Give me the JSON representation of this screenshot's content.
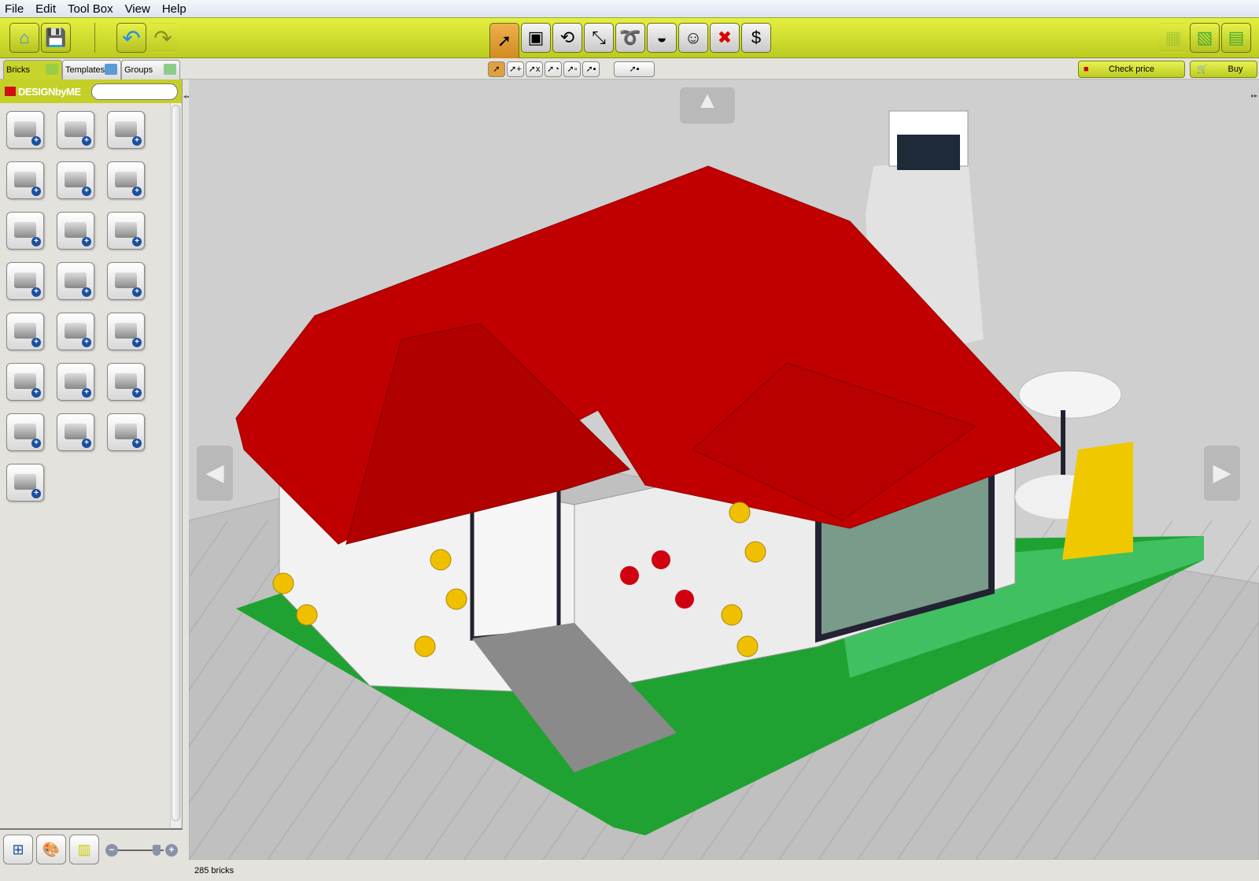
{
  "menu": [
    "File",
    "Edit",
    "Tool Box",
    "View",
    "Help"
  ],
  "toolbar": {
    "left": [
      {
        "icon": "home-icon",
        "g": "⌂"
      },
      {
        "icon": "save-icon",
        "g": "💾"
      },
      {
        "icon": "undo-icon",
        "g": "↶"
      },
      {
        "icon": "redo-icon",
        "g": "↷"
      }
    ],
    "center": [
      {
        "icon": "select-icon",
        "g": "➚"
      },
      {
        "icon": "add-brick-icon",
        "g": "▣"
      },
      {
        "icon": "hinge-icon",
        "g": "⟲"
      },
      {
        "icon": "hinge-align-icon",
        "g": "⤡"
      },
      {
        "icon": "flex-icon",
        "g": "➰"
      },
      {
        "icon": "paint-bucket-icon",
        "g": "◒"
      },
      {
        "icon": "minifig-head-icon",
        "g": "☺"
      },
      {
        "icon": "delete-icon",
        "g": "✖"
      },
      {
        "icon": "clone-icon",
        "g": "$"
      }
    ],
    "right": [
      {
        "icon": "build-mode-icon",
        "g": "▦"
      },
      {
        "icon": "view-mode-icon",
        "g": "▧"
      },
      {
        "icon": "building-guide-icon",
        "g": "▤"
      }
    ]
  },
  "tabs": [
    {
      "label": "Bricks"
    },
    {
      "label": "Templates"
    },
    {
      "label": "Groups"
    }
  ],
  "subtools": [
    "➚",
    "➚+",
    "➚x",
    "➚◔",
    "➚▫",
    "➚▪"
  ],
  "subtool_extra": "➚▪",
  "check_price": "Check price",
  "buy": "Buy",
  "brand": "DESIGNbyME",
  "brand_logo": "LEGO",
  "search": {
    "value": "",
    "placeholder": ""
  },
  "bricks": [
    "brick",
    "round-brick",
    "technic-brick",
    "long-brick",
    "slope",
    "curved-slope",
    "arch",
    "plate",
    "long-plate",
    "plate-modified",
    "tile",
    "tile-modified",
    "door",
    "wheel",
    "tool",
    "minifig",
    "minifig-head",
    "technic-beam",
    "axle",
    "gear",
    "cylinder",
    "baseplate"
  ],
  "status": "285 bricks",
  "zoom_level_percent": 85,
  "colors": {
    "accent": "#c4d028",
    "roof": "#c00000",
    "baseplate": "#22a033",
    "viewport": "#cfcfcf"
  }
}
